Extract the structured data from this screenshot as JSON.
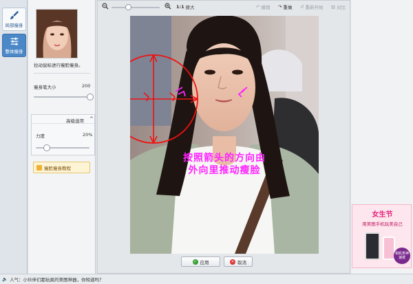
{
  "tabs": [
    {
      "label": "局部瘦身",
      "icon": "brush-icon"
    },
    {
      "label": "整体瘦身",
      "icon": "sliders-icon"
    }
  ],
  "panel": {
    "thumbnail_caption": "拉动鼠标进行瘦脸瘦身。",
    "brush_size_label": "瘦身笔大小",
    "brush_size_value": "200",
    "brush_size_fraction": 1.0,
    "advanced_label": "高级选项",
    "strength_label": "力度",
    "strength_value": "20%",
    "strength_fraction": 0.2,
    "tutorial_label": "瘦脸瘦身教程"
  },
  "toolbar": {
    "zoom_ratio": "1:1",
    "original_size": "原大",
    "undo": "撤销",
    "redo": "重做",
    "restart": "重新开始",
    "compare": "对比",
    "zoom_fraction": 0.35
  },
  "canvas": {
    "annotation_line1": "按照箭头的方向由",
    "annotation_line2": "外向里推动瘦脸"
  },
  "actions": {
    "apply": "应用",
    "cancel": "取消"
  },
  "ad": {
    "title": "女生节",
    "subtitle": "用美图手机玩美自己",
    "badge": "相机男神速拨"
  },
  "status": {
    "text": "人气：小伙伴们都玩疯的美图神器，你知道吗？"
  },
  "colors": {
    "accent_blue": "#4b88c8",
    "arrow_red": "#ee1111",
    "annotation_magenta": "#ff00ff"
  }
}
